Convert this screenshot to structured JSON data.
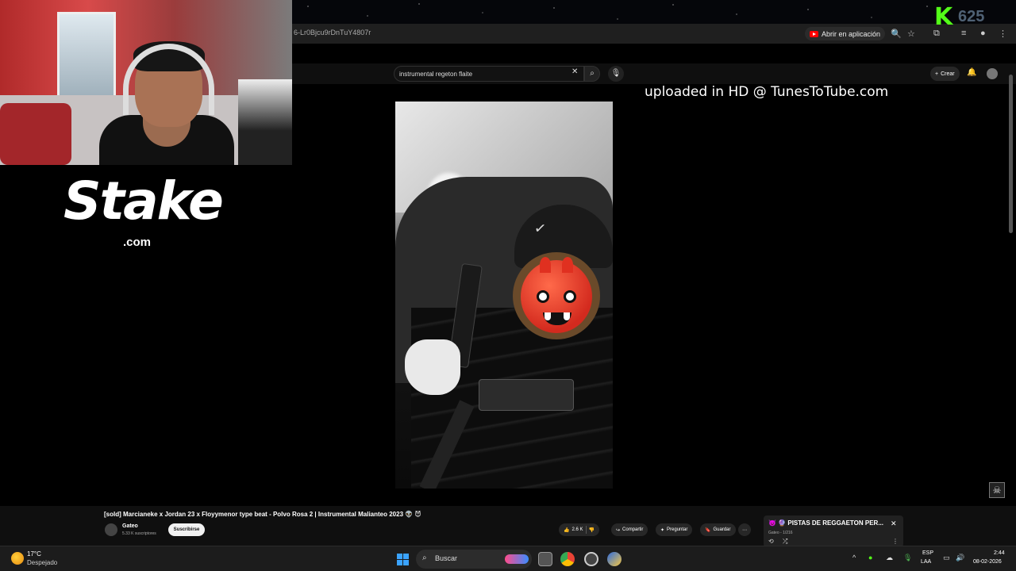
{
  "browser": {
    "url_fragment": "6-Lr0Bjcu9rDnTuY4807r",
    "open_app_label": "Abrir en aplicación"
  },
  "overlay": {
    "kick_logo": "K",
    "kick_number": "625",
    "sponsor_name": "Stake",
    "sponsor_tld": ".com"
  },
  "youtube": {
    "search_value": "instrumental regeton flaite",
    "create_label": "Crear",
    "video_overlay_text": "uploaded in HD @ TunesToTube.com",
    "video_title": "[sold] Marcianeke x Jordan 23 x Floyymenor type beat - Polvo Rosa 2 | Instrumental Malianteo 2023 👽 😈",
    "channel_name": "Gateo",
    "channel_subs": "5.33 K suscriptores",
    "subscribe_label": "Suscribirse",
    "like_count": "2.6 K",
    "share_label": "Compartir",
    "ask_label": "Preguntar",
    "save_label": "Guardar",
    "playlist_title": "👿 🔮 PISTAS DE REGGAETON PER...",
    "playlist_sub": "Gateo - 1/216"
  },
  "taskbar": {
    "temperature": "17°C",
    "condition": "Despejado",
    "search_label": "Buscar",
    "lang_line1": "ESP",
    "lang_line2": "LAA",
    "time": "2:44",
    "date": "08-02-2026"
  },
  "colors": {
    "kick_green": "#53fc18",
    "youtube_red": "#ff0000",
    "windows_blue": "#3aa3ff"
  }
}
